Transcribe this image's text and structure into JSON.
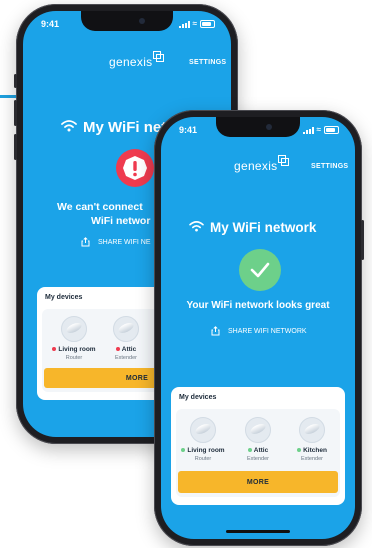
{
  "colors": {
    "screen_bg": "#1ba3e8",
    "success": "#6dd08a",
    "error": "#ef3b4f",
    "more_button": "#f7b62a",
    "online_dot": "#6dd08a",
    "offline_dot": "#ef3b4f"
  },
  "back": {
    "status_time": "9:41",
    "brand": "genexis",
    "settings": "SETTINGS",
    "title": "My WiFi netw",
    "message_line1": "We can't connect",
    "message_line2": "WiFi networ",
    "share": "SHARE WIFI NE",
    "devices_header": "My devices",
    "devices": [
      {
        "name": "Living room",
        "role": "Router",
        "status": "offline"
      },
      {
        "name": "Attic",
        "role": "Extender",
        "status": "offline"
      }
    ],
    "more": "MORE",
    "status_icon": "error-exclamation-icon"
  },
  "front": {
    "status_time": "9:41",
    "brand": "genexis",
    "settings": "SETTINGS",
    "title": "My WiFi network",
    "message": "Your WiFi network looks great",
    "share": "SHARE WIFI NETWORK",
    "devices_header": "My devices",
    "devices": [
      {
        "name": "Living room",
        "role": "Router",
        "status": "online"
      },
      {
        "name": "Attic",
        "role": "Extender",
        "status": "online"
      },
      {
        "name": "Kitchen",
        "role": "Extender",
        "status": "online"
      }
    ],
    "more": "MORE",
    "status_icon": "success-check-icon"
  }
}
